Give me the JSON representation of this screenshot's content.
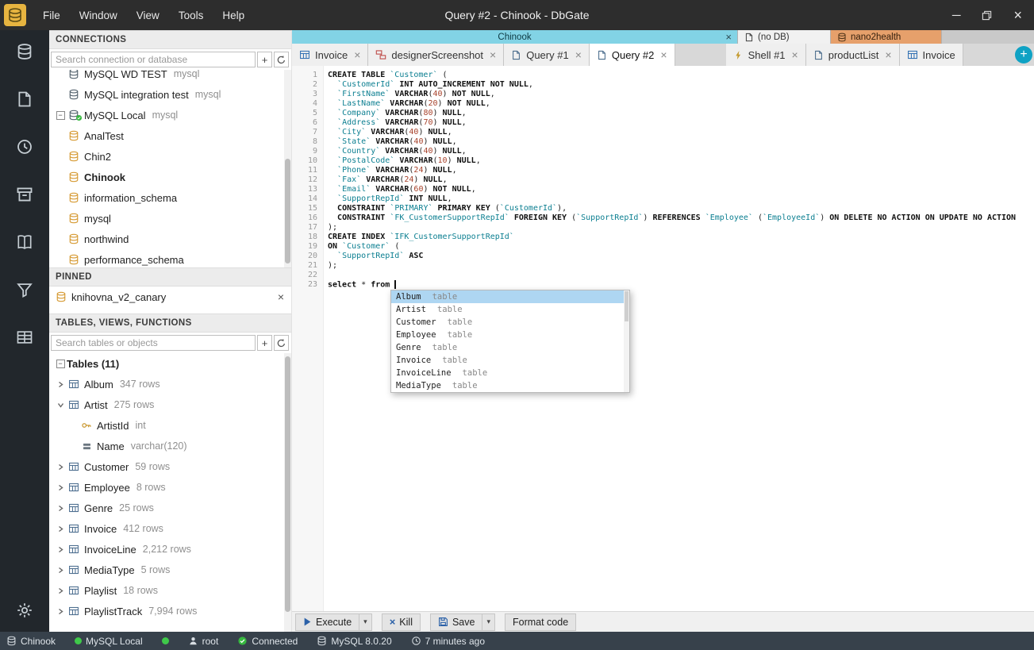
{
  "window": {
    "title": "Query #2 - Chinook - DbGate",
    "menus": [
      "File",
      "Window",
      "View",
      "Tools",
      "Help"
    ]
  },
  "icon_strip": {
    "items": [
      "database",
      "files",
      "history",
      "archive",
      "docs",
      "filter",
      "cells"
    ],
    "bottom": [
      "settings"
    ]
  },
  "colors": {
    "accent_cyan": "#0fa2c4",
    "tab_group_active": "#82d3e5",
    "tab_group_orange": "#e6a06b",
    "status_green": "#3fc94a",
    "db_amber": "#d69a33",
    "sql_keyword": "#111111",
    "sql_identifier": "#0c7f91",
    "sql_number": "#a8432c",
    "autocomplete_selection": "#aed6f2"
  },
  "connections": {
    "header": "CONNECTIONS",
    "search_placeholder": "Search connection or database",
    "items": [
      {
        "label": "MySQL WD TEST",
        "meta": "mysql",
        "icon": "db",
        "clip": "top"
      },
      {
        "label": "MySQL integration test",
        "meta": "mysql",
        "icon": "db"
      },
      {
        "label": "MySQL Local",
        "meta": "mysql",
        "icon": "db",
        "expander": "minus",
        "badge": "check"
      },
      {
        "label": "AnalTest",
        "icon": "db-amber"
      },
      {
        "label": "Chin2",
        "icon": "db-amber"
      },
      {
        "label": "Chinook",
        "icon": "db-amber",
        "bold": true
      },
      {
        "label": "information_schema",
        "icon": "db-amber"
      },
      {
        "label": "mysql",
        "icon": "db-amber"
      },
      {
        "label": "northwind",
        "icon": "db-amber"
      },
      {
        "label": "performance_schema",
        "icon": "db-amber"
      }
    ]
  },
  "pinned": {
    "header": "PINNED",
    "items": [
      {
        "label": "knihovna_v2_canary",
        "icon": "db-amber",
        "closable": true
      }
    ]
  },
  "tables_panel": {
    "header": "TABLES, VIEWS, FUNCTIONS",
    "search_placeholder": "Search tables or objects",
    "items": [
      {
        "label": "Tables (11)",
        "expander": "minus",
        "bold": true
      },
      {
        "label": "Album",
        "meta": "347 rows",
        "chevron": "right",
        "icon": "table"
      },
      {
        "label": "Artist",
        "meta": "275 rows",
        "chevron": "down",
        "icon": "table"
      },
      {
        "label": "ArtistId",
        "meta": "int",
        "icon": "key",
        "indent": 1
      },
      {
        "label": "Name",
        "meta": "varchar(120)",
        "icon": "column",
        "indent": 1
      },
      {
        "label": "Customer",
        "meta": "59 rows",
        "chevron": "right",
        "icon": "table"
      },
      {
        "label": "Employee",
        "meta": "8 rows",
        "chevron": "right",
        "icon": "table"
      },
      {
        "label": "Genre",
        "meta": "25 rows",
        "chevron": "right",
        "icon": "table"
      },
      {
        "label": "Invoice",
        "meta": "412 rows",
        "chevron": "right",
        "icon": "table"
      },
      {
        "label": "InvoiceLine",
        "meta": "2,212 rows",
        "chevron": "right",
        "icon": "table"
      },
      {
        "label": "MediaType",
        "meta": "5 rows",
        "chevron": "right",
        "icon": "table"
      },
      {
        "label": "Playlist",
        "meta": "18 rows",
        "chevron": "right",
        "icon": "table"
      },
      {
        "label": "PlaylistTrack",
        "meta": "7,994 rows",
        "chevron": "right",
        "icon": "table"
      }
    ]
  },
  "tab_groups": [
    {
      "label": "Chinook",
      "style": "cyan",
      "closable": true
    },
    {
      "label": "(no DB)",
      "style": "plain",
      "icon": "file"
    },
    {
      "label": "nano2health",
      "style": "orange",
      "icon": "db"
    }
  ],
  "tabs": [
    {
      "label": "Invoice",
      "icon": "table",
      "closable": true
    },
    {
      "label": "designerScreenshot",
      "icon": "designer",
      "closable": true
    },
    {
      "label": "Query #1",
      "icon": "query",
      "closable": true
    },
    {
      "label": "Query #2",
      "icon": "query",
      "closable": true,
      "active": true
    },
    {
      "label": "Shell #1",
      "icon": "shell",
      "closable": true,
      "gap": true
    },
    {
      "label": "productList",
      "icon": "query",
      "closable": true
    },
    {
      "label": "Invoice",
      "icon": "table",
      "clipped": true
    }
  ],
  "editor": {
    "lines": [
      [
        [
          "k",
          "CREATE TABLE"
        ],
        [
          "p",
          " "
        ],
        [
          "i",
          "`Customer`"
        ],
        [
          "p",
          " ("
        ]
      ],
      [
        [
          "p",
          "  "
        ],
        [
          "i",
          "`CustomerId`"
        ],
        [
          "p",
          " "
        ],
        [
          "k",
          "INT AUTO_INCREMENT NOT NULL"
        ],
        [
          "p",
          ","
        ]
      ],
      [
        [
          "p",
          "  "
        ],
        [
          "i",
          "`FirstName`"
        ],
        [
          "p",
          " "
        ],
        [
          "k",
          "VARCHAR"
        ],
        [
          "p",
          "("
        ],
        [
          "n",
          "40"
        ],
        [
          "p",
          ") "
        ],
        [
          "k",
          "NOT NULL"
        ],
        [
          "p",
          ","
        ]
      ],
      [
        [
          "p",
          "  "
        ],
        [
          "i",
          "`LastName`"
        ],
        [
          "p",
          " "
        ],
        [
          "k",
          "VARCHAR"
        ],
        [
          "p",
          "("
        ],
        [
          "n",
          "20"
        ],
        [
          "p",
          ") "
        ],
        [
          "k",
          "NOT NULL"
        ],
        [
          "p",
          ","
        ]
      ],
      [
        [
          "p",
          "  "
        ],
        [
          "i",
          "`Company`"
        ],
        [
          "p",
          " "
        ],
        [
          "k",
          "VARCHAR"
        ],
        [
          "p",
          "("
        ],
        [
          "n",
          "80"
        ],
        [
          "p",
          ") "
        ],
        [
          "k",
          "NULL"
        ],
        [
          "p",
          ","
        ]
      ],
      [
        [
          "p",
          "  "
        ],
        [
          "i",
          "`Address`"
        ],
        [
          "p",
          " "
        ],
        [
          "k",
          "VARCHAR"
        ],
        [
          "p",
          "("
        ],
        [
          "n",
          "70"
        ],
        [
          "p",
          ") "
        ],
        [
          "k",
          "NULL"
        ],
        [
          "p",
          ","
        ]
      ],
      [
        [
          "p",
          "  "
        ],
        [
          "i",
          "`City`"
        ],
        [
          "p",
          " "
        ],
        [
          "k",
          "VARCHAR"
        ],
        [
          "p",
          "("
        ],
        [
          "n",
          "40"
        ],
        [
          "p",
          ") "
        ],
        [
          "k",
          "NULL"
        ],
        [
          "p",
          ","
        ]
      ],
      [
        [
          "p",
          "  "
        ],
        [
          "i",
          "`State`"
        ],
        [
          "p",
          " "
        ],
        [
          "k",
          "VARCHAR"
        ],
        [
          "p",
          "("
        ],
        [
          "n",
          "40"
        ],
        [
          "p",
          ") "
        ],
        [
          "k",
          "NULL"
        ],
        [
          "p",
          ","
        ]
      ],
      [
        [
          "p",
          "  "
        ],
        [
          "i",
          "`Country`"
        ],
        [
          "p",
          " "
        ],
        [
          "k",
          "VARCHAR"
        ],
        [
          "p",
          "("
        ],
        [
          "n",
          "40"
        ],
        [
          "p",
          ") "
        ],
        [
          "k",
          "NULL"
        ],
        [
          "p",
          ","
        ]
      ],
      [
        [
          "p",
          "  "
        ],
        [
          "i",
          "`PostalCode`"
        ],
        [
          "p",
          " "
        ],
        [
          "k",
          "VARCHAR"
        ],
        [
          "p",
          "("
        ],
        [
          "n",
          "10"
        ],
        [
          "p",
          ") "
        ],
        [
          "k",
          "NULL"
        ],
        [
          "p",
          ","
        ]
      ],
      [
        [
          "p",
          "  "
        ],
        [
          "i",
          "`Phone`"
        ],
        [
          "p",
          " "
        ],
        [
          "k",
          "VARCHAR"
        ],
        [
          "p",
          "("
        ],
        [
          "n",
          "24"
        ],
        [
          "p",
          ") "
        ],
        [
          "k",
          "NULL"
        ],
        [
          "p",
          ","
        ]
      ],
      [
        [
          "p",
          "  "
        ],
        [
          "i",
          "`Fax`"
        ],
        [
          "p",
          " "
        ],
        [
          "k",
          "VARCHAR"
        ],
        [
          "p",
          "("
        ],
        [
          "n",
          "24"
        ],
        [
          "p",
          ") "
        ],
        [
          "k",
          "NULL"
        ],
        [
          "p",
          ","
        ]
      ],
      [
        [
          "p",
          "  "
        ],
        [
          "i",
          "`Email`"
        ],
        [
          "p",
          " "
        ],
        [
          "k",
          "VARCHAR"
        ],
        [
          "p",
          "("
        ],
        [
          "n",
          "60"
        ],
        [
          "p",
          ") "
        ],
        [
          "k",
          "NOT NULL"
        ],
        [
          "p",
          ","
        ]
      ],
      [
        [
          "p",
          "  "
        ],
        [
          "i",
          "`SupportRepId`"
        ],
        [
          "p",
          " "
        ],
        [
          "k",
          "INT NULL"
        ],
        [
          "p",
          ","
        ]
      ],
      [
        [
          "p",
          "  "
        ],
        [
          "k",
          "CONSTRAINT"
        ],
        [
          "p",
          " "
        ],
        [
          "i",
          "`PRIMARY`"
        ],
        [
          "p",
          " "
        ],
        [
          "k",
          "PRIMARY KEY"
        ],
        [
          "p",
          " ("
        ],
        [
          "i",
          "`CustomerId`"
        ],
        [
          "p",
          "),"
        ]
      ],
      [
        [
          "p",
          "  "
        ],
        [
          "k",
          "CONSTRAINT"
        ],
        [
          "p",
          " "
        ],
        [
          "i",
          "`FK_CustomerSupportRepId`"
        ],
        [
          "p",
          " "
        ],
        [
          "k",
          "FOREIGN KEY"
        ],
        [
          "p",
          " ("
        ],
        [
          "i",
          "`SupportRepId`"
        ],
        [
          "p",
          ") "
        ],
        [
          "k",
          "REFERENCES"
        ],
        [
          "p",
          " "
        ],
        [
          "i",
          "`Employee`"
        ],
        [
          "p",
          " ("
        ],
        [
          "i",
          "`EmployeeId`"
        ],
        [
          "p",
          ") "
        ],
        [
          "k",
          "ON DELETE NO ACTION ON UPDATE NO ACTION"
        ]
      ],
      [
        [
          "p",
          ");"
        ]
      ],
      [
        [
          "k",
          "CREATE INDEX"
        ],
        [
          "p",
          " "
        ],
        [
          "i",
          "`IFK_CustomerSupportRepId`"
        ]
      ],
      [
        [
          "k",
          "ON"
        ],
        [
          "p",
          " "
        ],
        [
          "i",
          "`Customer`"
        ],
        [
          "p",
          " ("
        ]
      ],
      [
        [
          "p",
          "  "
        ],
        [
          "i",
          "`SupportRepId`"
        ],
        [
          "p",
          " "
        ],
        [
          "k",
          "ASC"
        ]
      ],
      [
        [
          "p",
          ");"
        ]
      ],
      [],
      [
        [
          "k",
          "select"
        ],
        [
          "p",
          " * "
        ],
        [
          "k",
          "from"
        ],
        [
          "p",
          " "
        ],
        [
          "c",
          ""
        ]
      ]
    ],
    "autocomplete": [
      {
        "name": "Album",
        "kind": "table",
        "selected": true
      },
      {
        "name": "Artist",
        "kind": "table"
      },
      {
        "name": "Customer",
        "kind": "table"
      },
      {
        "name": "Employee",
        "kind": "table"
      },
      {
        "name": "Genre",
        "kind": "table"
      },
      {
        "name": "Invoice",
        "kind": "table"
      },
      {
        "name": "InvoiceLine",
        "kind": "table"
      },
      {
        "name": "MediaType",
        "kind": "table"
      }
    ]
  },
  "toolbar": {
    "execute": "Execute",
    "kill": "Kill",
    "save": "Save",
    "format_code": "Format code"
  },
  "statusbar": {
    "database": "Chinook",
    "connection": "MySQL Local",
    "user": "root",
    "status": "Connected",
    "server_version": "MySQL 8.0.20",
    "last_activity": "7 minutes ago"
  }
}
